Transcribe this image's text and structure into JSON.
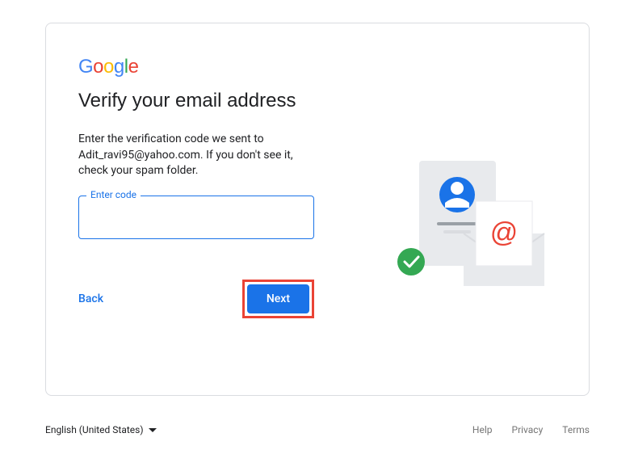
{
  "logo": {
    "g1": "G",
    "o1": "o",
    "o2": "o",
    "g2": "g",
    "l": "l",
    "e": "e"
  },
  "heading": "Verify your email address",
  "description": "Enter the verification code we sent to Adit_ravi95@yahoo.com. If you don't see it, check your spam folder.",
  "input": {
    "label": "Enter code",
    "value": ""
  },
  "buttons": {
    "back": "Back",
    "next": "Next"
  },
  "footer": {
    "language": "English (United States)",
    "links": {
      "help": "Help",
      "privacy": "Privacy",
      "terms": "Terms"
    }
  }
}
